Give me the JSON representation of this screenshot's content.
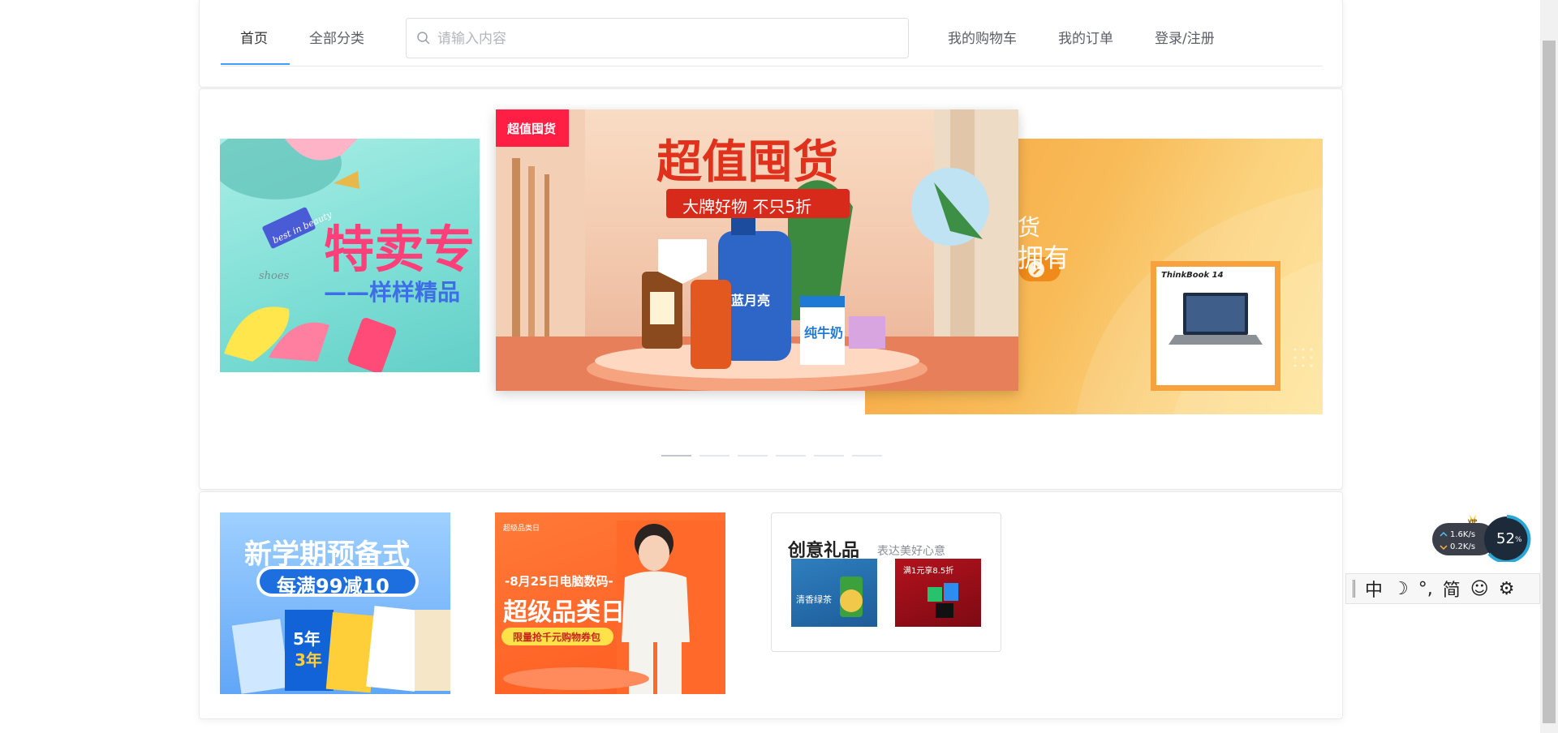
{
  "nav": {
    "tabs": [
      {
        "label": "首页",
        "active": true
      },
      {
        "label": "全部分类",
        "active": false
      }
    ],
    "search_placeholder": "请输入内容",
    "links": [
      "我的购物车",
      "我的订单",
      "登录/注册"
    ],
    "accent_color": "#409eff"
  },
  "carousel": {
    "slide_count": 6,
    "active_index": 0,
    "left": {
      "title": "特卖专",
      "subtitle": "——样样精品",
      "tag": "best in beauty",
      "caption": "shoes"
    },
    "center": {
      "badge": "超值囤货",
      "title": "超值囤货",
      "ribbon": "大牌好物 不只5折",
      "product_label": "纯牛奶",
      "brand_label": "蓝月亮"
    },
    "right": {
      "text_line1": "货",
      "text_line2": "拥有",
      "laptop_label": "ThinkBook 14"
    }
  },
  "promos": {
    "promo1": {
      "title": "新学期预备式",
      "subtitle": "每满99减10",
      "book_label": "5年",
      "book_label2": "3年"
    },
    "promo2": {
      "logo": "超级品类日",
      "date_line": "-8月25日电脑数码-",
      "title": "超级品类日",
      "cta": "限量抢千元购物券包"
    },
    "gift": {
      "title": "创意礼品",
      "subtitle": "表达美好心意",
      "img1_text": "清香绿茶",
      "img2_text": "满1元享8.5折"
    }
  },
  "widgets": {
    "net_up": "1.6K/s",
    "net_down": "0.2K/s",
    "cpu_percent": "52",
    "percent_sign": "%",
    "vip": "VIP",
    "ime": {
      "lang": "中",
      "moon": "☽",
      "punct": "°,",
      "script": "简",
      "emoji": "☺",
      "settings": "⚙"
    }
  }
}
